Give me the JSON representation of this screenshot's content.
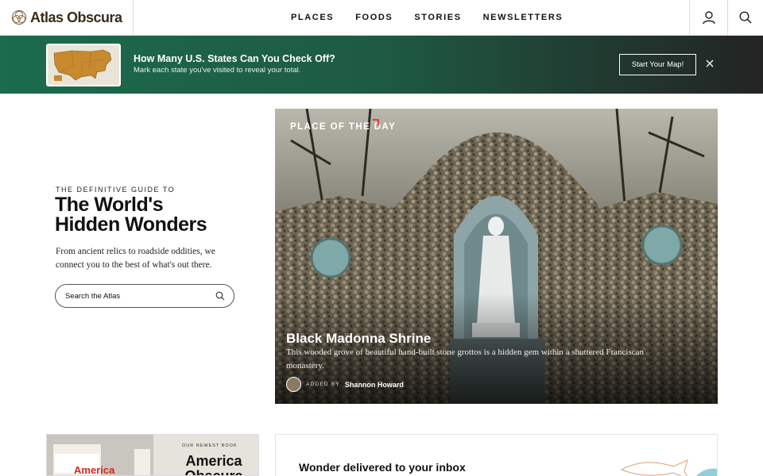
{
  "header": {
    "logo_text": "Atlas Obscura",
    "nav": [
      "PLACES",
      "FOODS",
      "STORIES",
      "NEWSLETTERS"
    ],
    "icons": [
      "user-icon",
      "search-icon"
    ]
  },
  "banner": {
    "title": "How Many U.S. States Can You Check Off?",
    "subtitle": "Mark each state you've visited to reveal your total.",
    "cta": "Start Your Map!",
    "close_icon": "close-icon"
  },
  "hero": {
    "eyebrow": "THE DEFINITIVE GUIDE TO",
    "title_line1": "The World's",
    "title_line2": "Hidden Wonders",
    "description": "From ancient relics to roadside oddities, we connect you to the best of what's out there.",
    "search_placeholder": "Search the Atlas"
  },
  "place_of_day": {
    "label": "PLACE OF THE DAY",
    "title": "Black Madonna Shrine",
    "description": "This wooded grove of beautiful hand-built stone grottos is a hidden gem within a shuttered Franciscan monastery.",
    "added_by": "ADDED BY",
    "author": "Shannon Howard"
  },
  "book": {
    "eyebrow": "OUR NEWEST BOOK",
    "title": "America Obscura",
    "cover_text": "America"
  },
  "newsletter": {
    "title": "Wonder delivered to your inbox"
  },
  "colors": {
    "banner_green": "#1c6b4e",
    "accent_red": "#e5402b",
    "logo_brown": "#3a2a1a"
  }
}
